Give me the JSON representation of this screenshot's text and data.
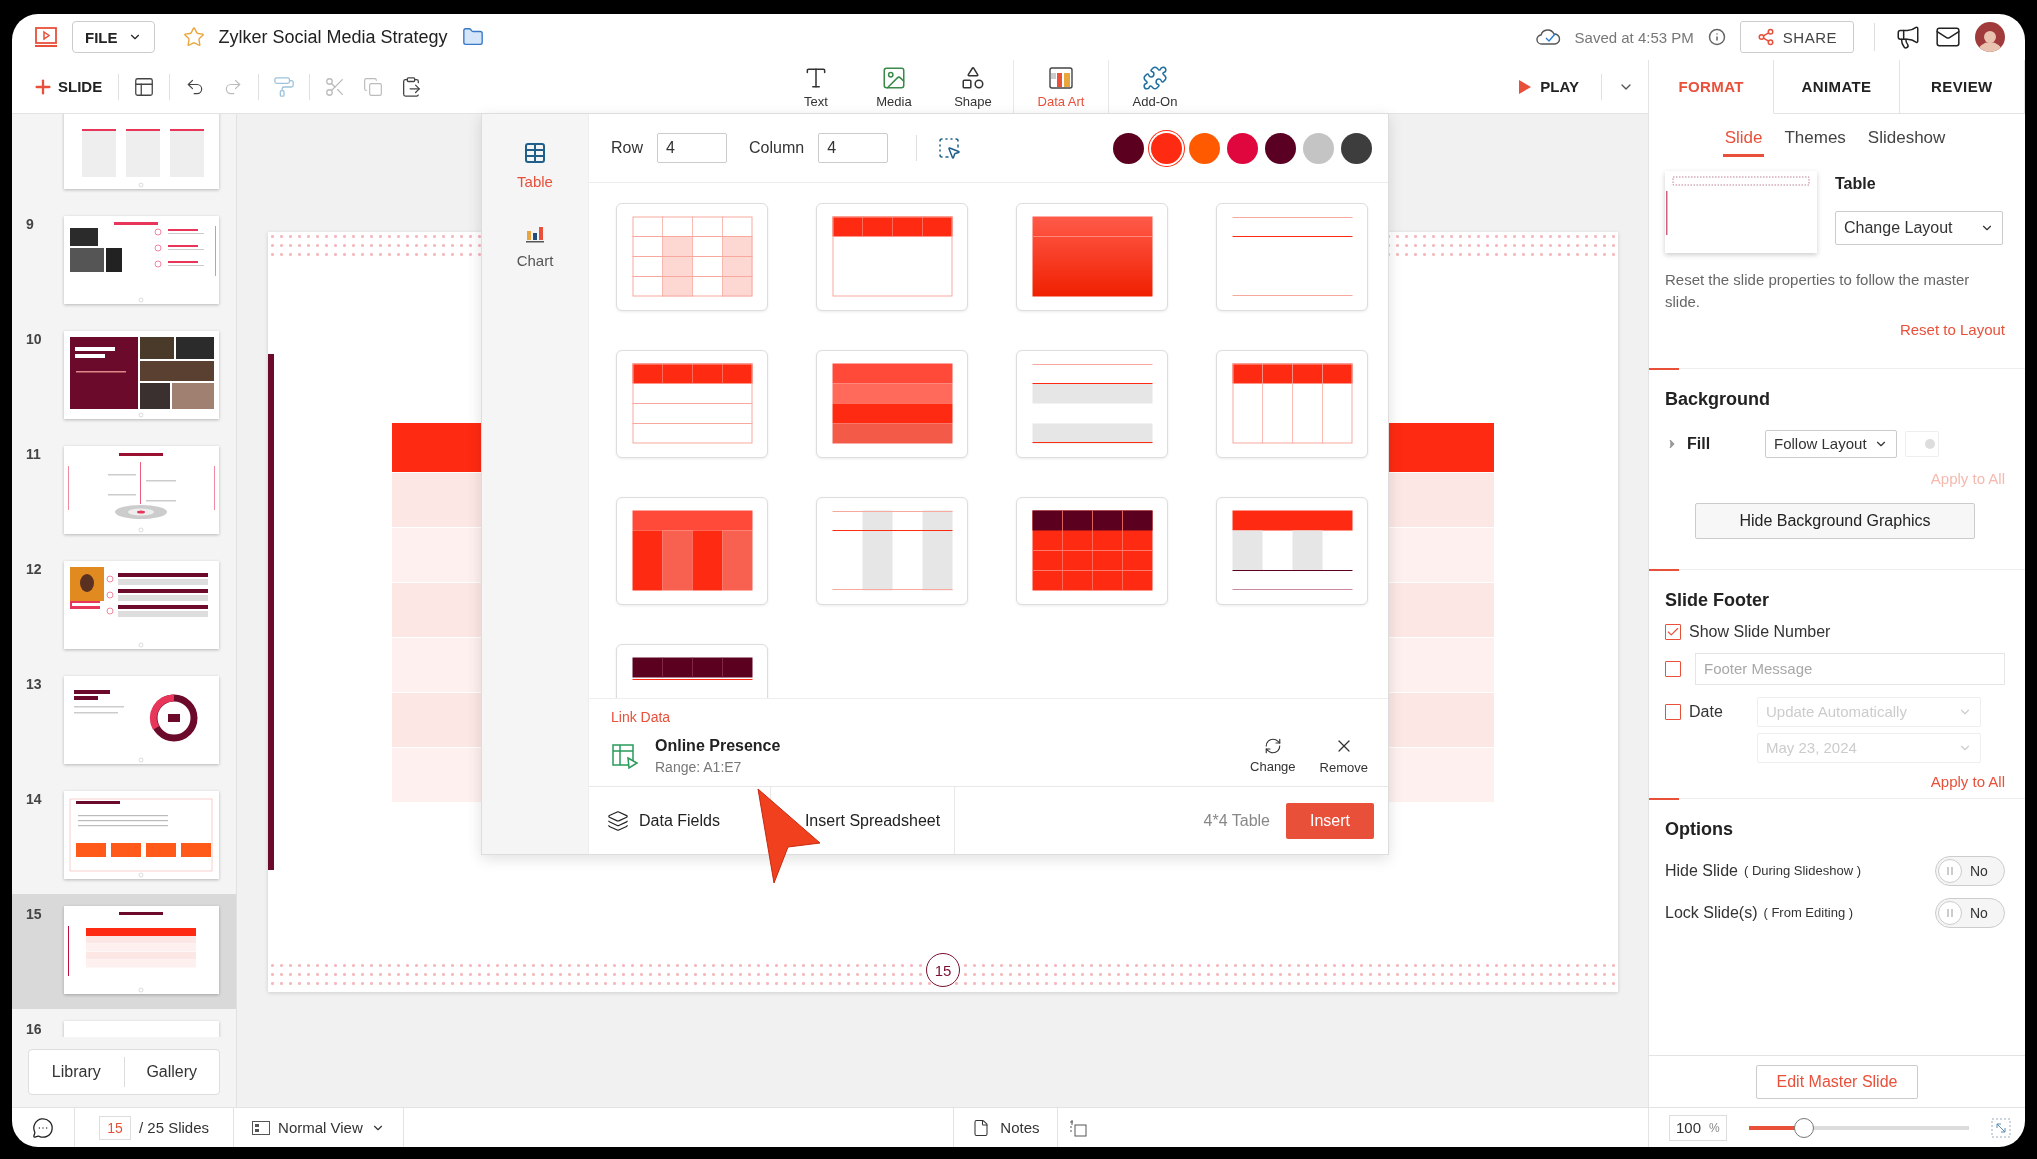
{
  "app": {
    "file_menu": "FILE",
    "title": "Zylker Social Media Strategy",
    "starred": false,
    "saved": "Saved at 4:53 PM",
    "share": "SHARE"
  },
  "toolbar": {
    "new_slide": "SLIDE",
    "play": "PLAY",
    "insert_tools": [
      {
        "kind": "text",
        "label": "Text",
        "selected": false
      },
      {
        "kind": "media",
        "label": "Media",
        "selected": false
      },
      {
        "kind": "shape",
        "label": "Shape",
        "selected": false
      },
      {
        "kind": "data-art",
        "label": "Data Art",
        "selected": true
      },
      {
        "kind": "add-on",
        "label": "Add-On",
        "selected": false
      }
    ]
  },
  "panel_tabs": [
    {
      "label": "FORMAT",
      "selected": true
    },
    {
      "label": "ANIMATE",
      "selected": false
    },
    {
      "label": "REVIEW",
      "selected": false
    }
  ],
  "slides": [
    {
      "kind": "columns",
      "selected": false
    },
    {
      "number": "9",
      "kind": "photos-left",
      "selected": false
    },
    {
      "number": "10",
      "kind": "maroon-photos",
      "selected": false
    },
    {
      "number": "11",
      "kind": "diagram",
      "selected": false
    },
    {
      "number": "12",
      "kind": "persona",
      "selected": false
    },
    {
      "number": "13",
      "kind": "donut",
      "selected": false
    },
    {
      "number": "14",
      "kind": "goals",
      "selected": false
    },
    {
      "number": "15",
      "kind": "table",
      "selected": true
    },
    {
      "number": "16",
      "kind": "blank",
      "selected": false
    }
  ],
  "library_buttons": [
    {
      "label": "Library",
      "selected": false
    },
    {
      "label": "Gallery",
      "selected": false
    }
  ],
  "slide": {
    "number": "15"
  },
  "data_art": {
    "side_tabs": [
      {
        "kind": "table",
        "label": "Table",
        "selected": true
      },
      {
        "kind": "chart",
        "label": "Chart",
        "selected": false
      }
    ],
    "row_label": "Row",
    "rows": "4",
    "column_label": "Column",
    "columns": "4",
    "swatches": [
      {
        "color": "#5c0020",
        "selected": false
      },
      {
        "color": "#ff2a12",
        "selected": true
      },
      {
        "color": "#ff5a00",
        "selected": false
      },
      {
        "color": "#e0073f",
        "selected": false
      },
      {
        "color": "#5a0022",
        "selected": false
      },
      {
        "color": "#c4c4c4",
        "selected": false
      },
      {
        "color": "#3d3d3d",
        "selected": false
      }
    ],
    "templates": [
      {
        "kind": "light-grid"
      },
      {
        "kind": "header"
      },
      {
        "kind": "gradient"
      },
      {
        "kind": "lines"
      },
      {
        "kind": "header-rows"
      },
      {
        "kind": "banded"
      },
      {
        "kind": "gray-bands"
      },
      {
        "kind": "header-columns"
      },
      {
        "kind": "gradient-columns"
      },
      {
        "kind": "gray-columns"
      },
      {
        "kind": "dark-header"
      },
      {
        "kind": "header-gray-cells"
      },
      {
        "kind": "dark-header-cut"
      }
    ],
    "link": {
      "heading": "Link Data",
      "name": "Online Presence",
      "range": "Range: A1:E7",
      "actions": [
        {
          "kind": "change",
          "label": "Change"
        },
        {
          "kind": "remove",
          "label": "Remove"
        }
      ]
    },
    "footer_tabs": [
      {
        "kind": "fields",
        "label": "Data Fields"
      },
      {
        "kind": "spreadsheet",
        "label": "Insert Spreadsheet"
      }
    ],
    "summary": "4*4 Table",
    "insert": "Insert"
  },
  "format": {
    "sub_tabs": [
      {
        "label": "Slide",
        "selected": true
      },
      {
        "label": "Themes",
        "selected": false
      },
      {
        "label": "Slideshow",
        "selected": false
      }
    ],
    "layout_name": "Table",
    "change_layout": "Change Layout",
    "reset_note": "Reset the slide properties to follow the master slide.",
    "reset_link": "Reset to Layout",
    "background": {
      "heading": "Background",
      "fill_label": "Fill",
      "fill_value": "Follow Layout",
      "apply_all": "Apply to All",
      "apply_enabled": false,
      "hide_graphics": "Hide Background Graphics"
    },
    "footer": {
      "heading": "Slide Footer",
      "show_number": {
        "label": "Show Slide Number",
        "checked": true
      },
      "message": {
        "checked": false,
        "placeholder": "Footer Message"
      },
      "date": {
        "label": "Date",
        "checked": false,
        "mode": "Update Automatically",
        "value": "May 23, 2024"
      },
      "apply_all": "Apply to All"
    },
    "options": {
      "heading": "Options",
      "items": [
        {
          "label": "Hide Slide",
          "note": "( During Slideshow )",
          "on": false,
          "state_label": "No"
        },
        {
          "label": "Lock Slide(s)",
          "note": "( From Editing )",
          "on": false,
          "state_label": "No"
        }
      ]
    },
    "edit_master": "Edit Master Slide"
  },
  "status_bar": {
    "current_slide": "15",
    "total": "/ 25 Slides",
    "view": "Normal View",
    "notes": "Notes",
    "zoom": "100",
    "zoom_unit": "%",
    "zoom_slider": {
      "level": 0.25
    }
  }
}
